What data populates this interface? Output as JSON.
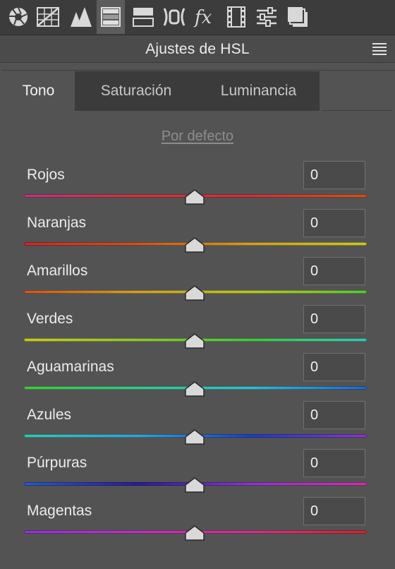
{
  "toolbar": {
    "icons": [
      "aperture-icon",
      "curve-grid-icon",
      "detail-mountains-icon",
      "hsl-bands-icon",
      "split-toning-icon",
      "lens-correction-icon",
      "fx-effects-icon",
      "film-calibration-icon",
      "sliders-presets-icon",
      "snapshots-icon"
    ],
    "active_index": 3
  },
  "panel": {
    "title": "Ajustes de HSL",
    "menu_icon": "panel-menu-icon"
  },
  "tabs": [
    {
      "label": "Tono",
      "selected": true
    },
    {
      "label": "Saturación",
      "selected": false
    },
    {
      "label": "Luminancia",
      "selected": false
    }
  ],
  "default_link": "Por defecto",
  "sliders": [
    {
      "label": "Rojos",
      "value": "0",
      "gradient": [
        "#b03a7e",
        "#c23c3c",
        "#c2383a",
        "#c2572a"
      ]
    },
    {
      "label": "Naranjas",
      "value": "0",
      "gradient": [
        "#c22d2d",
        "#c2572a",
        "#c9a030",
        "#c9c52a"
      ]
    },
    {
      "label": "Amarillos",
      "value": "0",
      "gradient": [
        "#c25a2a",
        "#c9a030",
        "#b6c22c",
        "#5cc23c"
      ]
    },
    {
      "label": "Verdes",
      "value": "0",
      "gradient": [
        "#c9c52a",
        "#8ec23a",
        "#4cc24a",
        "#3ec2b4"
      ]
    },
    {
      "label": "Aguamarinas",
      "value": "0",
      "gradient": [
        "#4cc24a",
        "#3ec28c",
        "#3ab8c9",
        "#2a66c2"
      ]
    },
    {
      "label": "Azules",
      "value": "0",
      "gradient": [
        "#3ec2b4",
        "#3aa0c9",
        "#1e3fc2",
        "#8a3ac2"
      ]
    },
    {
      "label": "Púrpuras",
      "value": "0",
      "gradient": [
        "#2a5ac2",
        "#2a1e9c",
        "#8a3ac2",
        "#c23aa0"
      ]
    },
    {
      "label": "Magentas",
      "value": "0",
      "gradient": [
        "#8a3ac2",
        "#b03ab4",
        "#c23a84",
        "#c22d2d"
      ]
    }
  ],
  "colors": {
    "background": "#535353",
    "toolbar": "#3c3c3c",
    "header": "#4b4b4b",
    "tab_inactive": "#3b3b3b",
    "input_border": "#707070"
  }
}
